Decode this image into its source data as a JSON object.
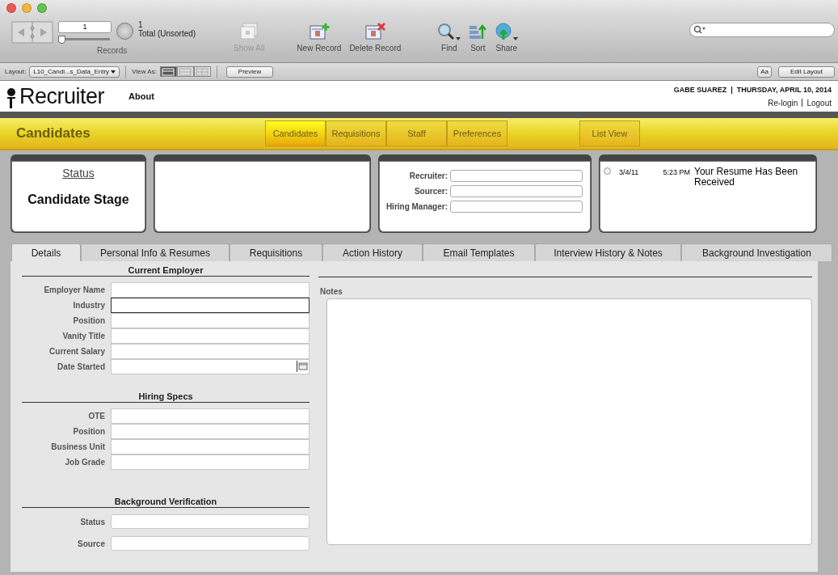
{
  "window": {
    "controls": [
      {
        "kind": "close"
      },
      {
        "kind": "minimize"
      },
      {
        "kind": "zoom"
      }
    ]
  },
  "toolbar": {
    "record_number": "1",
    "slider": {
      "level": 0
    },
    "found_count": "1",
    "total_label": "Total (Unsorted)",
    "records_label": "Records",
    "buttons": [
      {
        "kind": "show-all",
        "label": "Show All",
        "disabled": true,
        "menu": false
      },
      {
        "kind": "new-record",
        "label": "New Record",
        "disabled": false,
        "menu": false
      },
      {
        "kind": "delete-record",
        "label": "Delete Record",
        "disabled": false,
        "menu": false
      },
      {
        "kind": "find",
        "label": "Find",
        "disabled": false,
        "menu": true
      },
      {
        "kind": "sort",
        "label": "Sort",
        "disabled": false,
        "menu": false
      },
      {
        "kind": "share",
        "label": "Share",
        "disabled": false,
        "menu": true
      }
    ]
  },
  "layout_bar": {
    "layout_label": "Layout:",
    "layout_value": "L10_Candi...s_Data_Entry",
    "view_as_label": "View As:",
    "views": [
      {
        "kind": "form",
        "selected": true
      },
      {
        "kind": "list",
        "selected": false
      },
      {
        "kind": "table",
        "selected": false
      }
    ],
    "preview": "Preview",
    "format_button": "Aa",
    "edit_layout": "Edit Layout"
  },
  "header": {
    "logo": "Recruiter",
    "about": "About",
    "user": "GABE SUAREZ",
    "separator": "|",
    "date": "THURSDAY, APRIL 10, 2014",
    "links": [
      "Re-login",
      "Logout"
    ]
  },
  "section_bar": {
    "title": "Candidates",
    "nav": [
      {
        "label": "Candidates",
        "selected": true
      },
      {
        "label": "Requisitions",
        "selected": false
      },
      {
        "label": "Staff",
        "selected": false
      },
      {
        "label": "Preferences",
        "selected": false
      }
    ],
    "list_view": "List View"
  },
  "status_card": {
    "heading": "Status",
    "stage": "Candidate Stage"
  },
  "people_fields": [
    {
      "label": "Recruiter:"
    },
    {
      "label": "Sourcer:"
    },
    {
      "label": "Hiring Manager:"
    }
  ],
  "activity": [
    {
      "date": "3/4/11",
      "time": "5:23 PM",
      "text": "Your Resume Has Been Received",
      "selected": false
    }
  ],
  "tabs": [
    {
      "label": "Details",
      "selected": true
    },
    {
      "label": "Personal Info & Resumes",
      "selected": false
    },
    {
      "label": "Requisitions",
      "selected": false
    },
    {
      "label": "Action History",
      "selected": false
    },
    {
      "label": "Email Templates",
      "selected": false
    },
    {
      "label": "Interview History & Notes",
      "selected": false
    },
    {
      "label": "Background Investigation",
      "selected": false
    }
  ],
  "sections": [
    {
      "heading": "Current Employer",
      "grouped": true,
      "fields": [
        {
          "label": "Employer Name",
          "kind": "text",
          "focused": false
        },
        {
          "label": "Industry",
          "kind": "text",
          "focused": true
        },
        {
          "label": "Position",
          "kind": "text",
          "focused": false
        },
        {
          "label": "Vanity Title",
          "kind": "text",
          "focused": false
        },
        {
          "label": "Current Salary",
          "kind": "text",
          "focused": false
        },
        {
          "label": "Date Started",
          "kind": "date",
          "focused": false
        }
      ]
    },
    {
      "heading": "Hiring Specs",
      "grouped": true,
      "fields": [
        {
          "label": "OTE",
          "kind": "text",
          "focused": false
        },
        {
          "label": "Position",
          "kind": "text",
          "focused": false
        },
        {
          "label": "Business Unit",
          "kind": "text",
          "focused": false
        },
        {
          "label": "Job Grade",
          "kind": "text",
          "focused": false
        }
      ]
    },
    {
      "heading": "Background Verification",
      "grouped": false,
      "fields": [
        {
          "label": "Status",
          "kind": "text",
          "focused": false
        },
        {
          "label": "Source",
          "kind": "text",
          "focused": false
        }
      ]
    }
  ],
  "notes": {
    "label": "Notes"
  }
}
